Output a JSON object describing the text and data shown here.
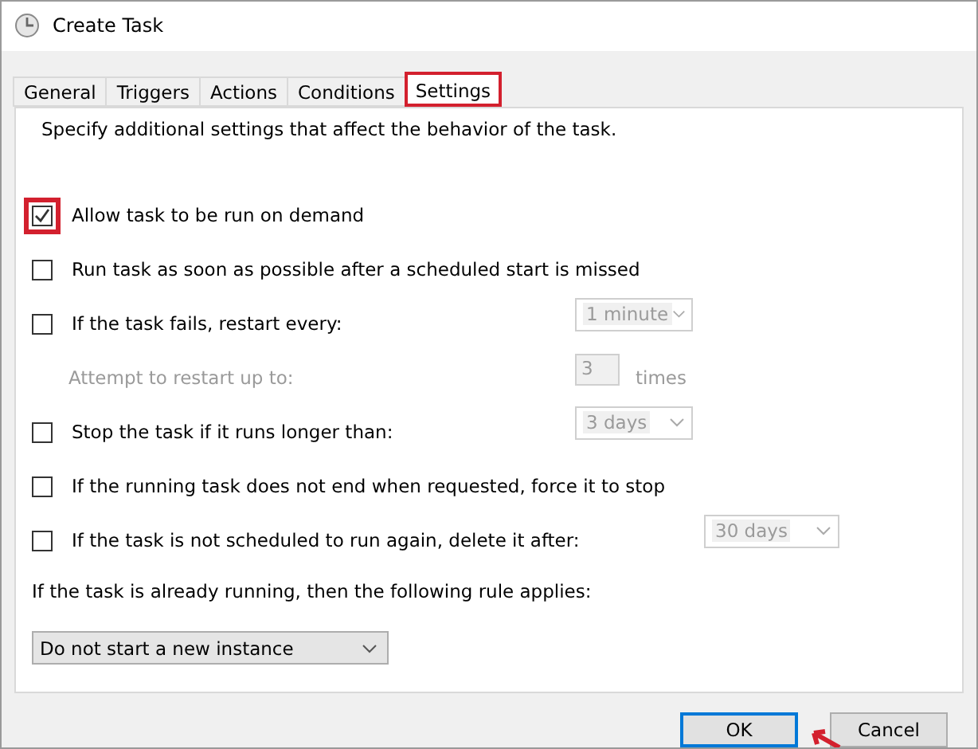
{
  "window": {
    "title": "Create Task"
  },
  "tabs": [
    {
      "label": "General",
      "selected": false,
      "highlighted": false
    },
    {
      "label": "Triggers",
      "selected": false,
      "highlighted": false
    },
    {
      "label": "Actions",
      "selected": false,
      "highlighted": false
    },
    {
      "label": "Conditions",
      "selected": false,
      "highlighted": false
    },
    {
      "label": "Settings",
      "selected": true,
      "highlighted": true
    }
  ],
  "description": "Specify additional settings that affect the behavior of the task.",
  "options": [
    {
      "kind": "check",
      "label": "Allow task to be run on demand",
      "checked": true,
      "highlighted": true
    },
    {
      "kind": "check",
      "label": "Run task as soon as possible after a scheduled start is missed",
      "checked": false,
      "highlighted": false
    },
    {
      "kind": "check",
      "label": "If the task fails, restart every:",
      "checked": false,
      "highlighted": false,
      "control": {
        "value": "1 minute",
        "disabled": true,
        "wide": false
      }
    },
    {
      "kind": "sub",
      "label": "Attempt to restart up to:",
      "disabled": true,
      "field": "3",
      "suffix": "times"
    },
    {
      "kind": "check",
      "label": "Stop the task if it runs longer than:",
      "checked": false,
      "highlighted": false,
      "control": {
        "value": "3 days",
        "disabled": true,
        "wide": false
      }
    },
    {
      "kind": "check",
      "label": "If the running task does not end when requested, force it to stop",
      "checked": false,
      "highlighted": false
    },
    {
      "kind": "check",
      "label": "If the task is not scheduled to run again, delete it after:",
      "checked": false,
      "highlighted": false,
      "control": {
        "value": "30 days",
        "disabled": true,
        "wide": true
      }
    }
  ],
  "rule_label": "If the task is already running, then the following rule applies:",
  "rule_select": "Do not start a new instance",
  "buttons": [
    "OK",
    "Cancel"
  ]
}
